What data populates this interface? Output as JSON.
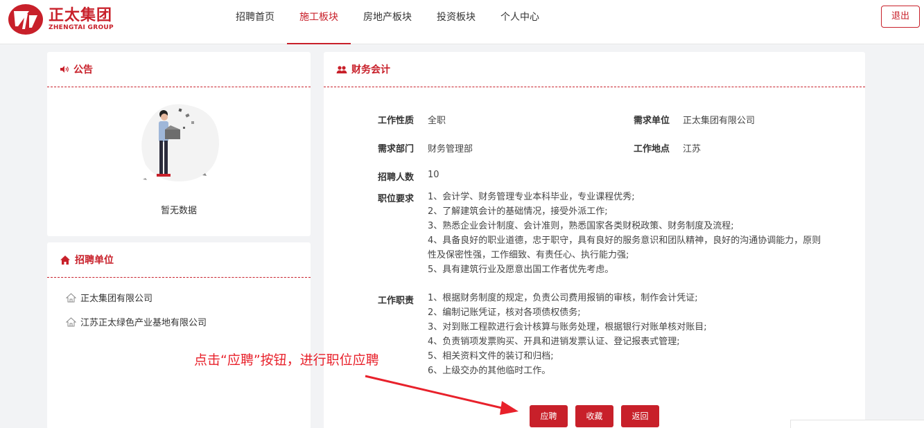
{
  "brand": {
    "name_cn": "正太集团",
    "name_en": "ZHENGTAI GROUP"
  },
  "nav": {
    "items": [
      {
        "label": "招聘首页"
      },
      {
        "label": "施工板块",
        "active": true
      },
      {
        "label": "房地产板块"
      },
      {
        "label": "投资板块"
      },
      {
        "label": "个人中心"
      }
    ],
    "logout_label": "退出"
  },
  "notice": {
    "title": "公告",
    "empty_text": "暂无数据"
  },
  "units": {
    "title": "招聘单位",
    "items": [
      "正太集团有限公司",
      "江苏正太绿色产业基地有限公司"
    ]
  },
  "job": {
    "title": "财务会计",
    "nature_label": "工作性质",
    "nature": "全职",
    "unit_label": "需求单位",
    "unit": "正太集团有限公司",
    "dept_label": "需求部门",
    "dept": "财务管理部",
    "location_label": "工作地点",
    "location": "江苏",
    "count_label": "招聘人数",
    "count": "10",
    "requirements_label": "职位要求",
    "requirements": [
      "1、会计学、财务管理专业本科毕业，专业课程优秀;",
      "2、了解建筑会计的基础情况，接受外派工作;",
      "3、熟悉企业会计制度、会计准则，熟悉国家各类财税政策、财务制度及流程;",
      "4、具备良好的职业道德，忠于职守，具有良好的服务意识和团队精神，良好的沟通协调能力，原则",
      "性及保密性强，工作细致、有责任心、执行能力强;",
      "5、具有建筑行业及愿意出国工作者优先考虑。"
    ],
    "duties_label": "工作职责",
    "duties": [
      "1、根据财务制度的规定，负责公司费用报销的审核，制作会计凭证;",
      "2、编制记账凭证，核对各项债权债务;",
      "3、对到账工程款进行会计核算与账务处理，根据银行对账单核对账目;",
      "4、负责销项发票购买、开具和进销发票认证、登记报表式管理;",
      "5、相关资料文件的装订和归档;",
      "6、上级交办的其他临时工作。"
    ],
    "buttons": {
      "apply": "应聘",
      "favorite": "收藏",
      "back": "返回"
    }
  },
  "annotation": {
    "text": "点击“应聘”按钮，进行职位应聘"
  },
  "colors": {
    "brand": "#c8202a",
    "annotation": "#e8212b"
  }
}
